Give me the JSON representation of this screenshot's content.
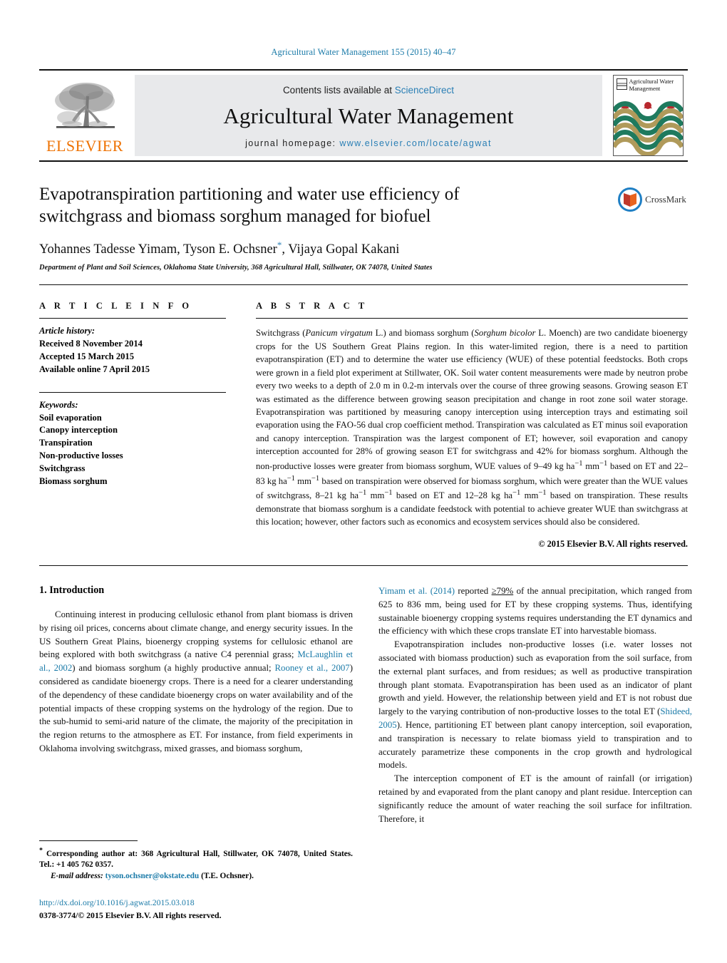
{
  "running_head": "Agricultural Water Management 155 (2015) 40–47",
  "masthead": {
    "contents_prefix": "Contents lists available at ",
    "sciencedirect": "ScienceDirect",
    "journal_title": "Agricultural Water Management",
    "homepage_prefix": "journal homepage: ",
    "homepage_url": "www.elsevier.com/locate/agwat",
    "publisher_wordmark": "ELSEVIER",
    "cover_title": "Agricultural Water Management",
    "accent_link_color": "#2a7fb5",
    "publisher_orange": "#ee7203"
  },
  "badge": {
    "crossmark_label": "CrossMark"
  },
  "article": {
    "title": "Evapotranspiration partitioning and water use efficiency of switchgrass and biomass sorghum managed for biofuel",
    "authors_part1": "Yohannes Tadesse Yimam, Tyson E. Ochsner",
    "corresponding_marker": "*",
    "authors_part2": ", Vijaya Gopal Kakani",
    "affiliation": "Department of Plant and Soil Sciences, Oklahoma State University, 368 Agricultural Hall, Stillwater, OK 74078, United States"
  },
  "article_info": {
    "heading": "A R T I C L E   I N F O",
    "history_label": "Article history:",
    "history": [
      "Received 8 November 2014",
      "Accepted 15 March 2015",
      "Available online 7 April 2015"
    ],
    "keywords_label": "Keywords:",
    "keywords": [
      "Soil evaporation",
      "Canopy interception",
      "Transpiration",
      "Non-productive losses",
      "Switchgrass",
      "Biomass sorghum"
    ]
  },
  "abstract": {
    "heading": "A B S T R A C T",
    "segments": [
      {
        "t": "Switchgrass ("
      },
      {
        "t": "Panicum virgatum",
        "style": "italic"
      },
      {
        "t": " L.) and biomass sorghum ("
      },
      {
        "t": "Sorghum bicolor",
        "style": "italic"
      },
      {
        "t": " L. Moench) are two candidate bioenergy crops for the US Southern Great Plains region. In this water-limited region, there is a need to partition evapotranspiration (ET) and to determine the water use efficiency (WUE) of these potential feedstocks. Both crops were grown in a field plot experiment at Stillwater, OK. Soil water content measurements were made by neutron probe every two weeks to a depth of 2.0 m in 0.2-m intervals over the course of three growing seasons. Growing season ET was estimated as the difference between growing season precipitation and change in root zone soil water storage. Evapotranspiration was partitioned by measuring canopy interception using interception trays and estimating soil evaporation using the FAO-56 dual crop coefficient method. Transpiration was calculated as ET minus soil evaporation and canopy interception. Transpiration was the largest component of ET; however, soil evaporation and canopy interception accounted for 28% of growing season ET for switchgrass and 42% for biomass sorghum. Although the non-productive losses were greater from biomass sorghum, WUE values of 9–49 kg ha"
      },
      {
        "t": "−1",
        "style": "sup"
      },
      {
        "t": " mm"
      },
      {
        "t": "−1",
        "style": "sup"
      },
      {
        "t": " based on ET and 22–83 kg ha"
      },
      {
        "t": "−1",
        "style": "sup"
      },
      {
        "t": " mm"
      },
      {
        "t": "−1",
        "style": "sup"
      },
      {
        "t": " based on transpiration were observed for biomass sorghum, which were greater than the WUE values of switchgrass, 8–21 kg ha"
      },
      {
        "t": "−1",
        "style": "sup"
      },
      {
        "t": " mm"
      },
      {
        "t": "−1",
        "style": "sup"
      },
      {
        "t": " based on ET and 12–28 kg ha"
      },
      {
        "t": "−1",
        "style": "sup"
      },
      {
        "t": " mm"
      },
      {
        "t": "−1",
        "style": "sup"
      },
      {
        "t": " based on transpiration. These results demonstrate that biomass sorghum is a candidate feedstock with potential to achieve greater WUE than switchgrass at this location; however, other factors such as economics and ecosystem services should also be considered."
      }
    ],
    "copyright": "© 2015 Elsevier B.V. All rights reserved."
  },
  "introduction": {
    "heading": "1.  Introduction",
    "left_paragraphs": [
      [
        {
          "t": "Continuing interest in producing cellulosic ethanol from plant biomass is driven by rising oil prices, concerns about climate change, and energy security issues. In the US Southern Great Plains, bioenergy cropping systems for cellulosic ethanol are being explored with both switchgrass (a native C4 perennial grass; "
        },
        {
          "t": "McLaughlin et al., 2002",
          "style": "cite"
        },
        {
          "t": ") and biomass sorghum (a highly productive annual; "
        },
        {
          "t": "Rooney et al., 2007",
          "style": "cite"
        },
        {
          "t": ") considered as candidate bioenergy crops. There is a need for a clearer understanding of the dependency of these candidate bioenergy crops on water availability and of the potential impacts of these cropping systems on the hydrology of the region. Due to the sub-humid to semi-arid nature of the climate, the majority of the precipitation in the region returns to the atmosphere as ET. For instance, from field experiments in Oklahoma involving switchgrass, mixed grasses, and biomass sorghum,"
        }
      ]
    ],
    "right_paragraphs": [
      [
        {
          "t": "Yimam et al. (2014)",
          "style": "cite"
        },
        {
          "t": " reported "
        },
        {
          "t": "≥79%",
          "style": "underline"
        },
        {
          "t": " of the annual precipitation, which ranged from 625 to 836 mm, being used for ET by these cropping systems. Thus, identifying sustainable bioenergy cropping systems requires understanding the ET dynamics and the efficiency with which these crops translate ET into harvestable biomass."
        }
      ],
      [
        {
          "t": "Evapotranspiration includes non-productive losses (i.e. water losses not associated with biomass production) such as evaporation from the soil surface, from the external plant surfaces, and from residues; as well as productive transpiration through plant stomata. Evapotranspiration has been used as an indicator of plant growth and yield. However, the relationship between yield and ET is not robust due largely to the varying contribution of non-productive losses to the total ET ("
        },
        {
          "t": "Shideed, 2005",
          "style": "cite"
        },
        {
          "t": "). Hence, partitioning ET between plant canopy interception, soil evaporation, and transpiration is necessary to relate biomass yield to transpiration and to accurately parametrize these components in the crop growth and hydrological models."
        }
      ],
      [
        {
          "t": "The interception component of ET is the amount of rainfall (or irrigation) retained by and evaporated from the plant canopy and plant residue. Interception can significantly reduce the amount of water reaching the soil surface for infiltration. Therefore, it"
        }
      ]
    ]
  },
  "footnotes": {
    "corresponding_marker": "*",
    "corresponding_text": " Corresponding author at: 368 Agricultural Hall, Stillwater, OK 74078, United States. Tel.: +1 405 762 0357.",
    "email_label": "E-mail address:",
    "email": "tyson.ochsner@okstate.edu",
    "email_owner": "(T.E. Ochsner).",
    "doi": "http://dx.doi.org/10.1016/j.agwat.2015.03.018",
    "issn_line": "0378-3774/© 2015 Elsevier B.V. All rights reserved."
  }
}
